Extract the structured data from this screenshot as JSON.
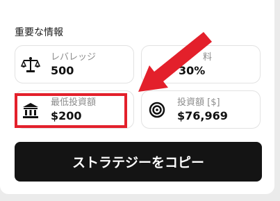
{
  "section": {
    "title": "重要な情報"
  },
  "cards": [
    {
      "icon": "scale-icon",
      "label": "レバレッジ",
      "value": "500"
    },
    {
      "icon": "fee-icon",
      "label": "料",
      "value": "30%"
    },
    {
      "icon": "bank-icon",
      "label": "最低投資額",
      "value": "$200"
    },
    {
      "icon": "target-icon",
      "label": "投資額 [$]",
      "value": "$76,969"
    }
  ],
  "actions": {
    "copy_label": "ストラテジーをコピー"
  },
  "colors": {
    "highlight": "#e3202b",
    "button_bg": "#141414"
  }
}
